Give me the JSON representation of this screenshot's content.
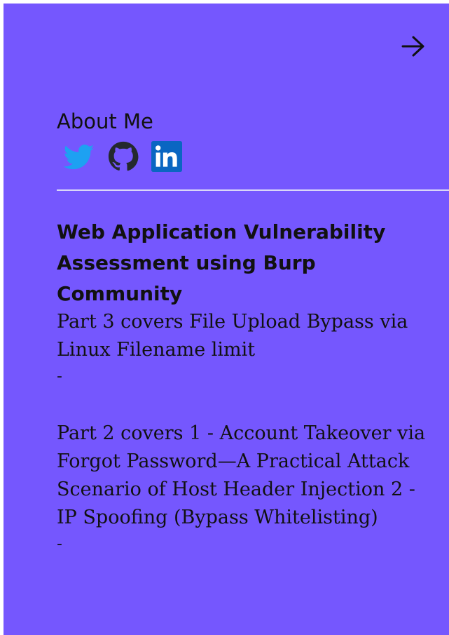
{
  "navigation": {
    "forward_icon": "arrow-right-icon"
  },
  "about": {
    "title": "About Me",
    "social_links": [
      {
        "name": "twitter",
        "icon": "twitter-icon",
        "color": "#1da1f2"
      },
      {
        "name": "github",
        "icon": "github-icon",
        "color": "#24292e"
      },
      {
        "name": "linkedin",
        "icon": "linkedin-icon",
        "color": "#0a66c2"
      }
    ]
  },
  "section": {
    "heading": "Web Application Vulnerability Assessment using Burp Community"
  },
  "posts": [
    {
      "text": "Part 3 covers File Upload Bypass via Linux Filename limit",
      "separator": "-"
    },
    {
      "text": "Part 2 covers 1 - Account Takeover via Forgot Password—A Practical Attack Scenario of Host Header Injection 2 - IP Spoofing (Bypass Whitelisting)",
      "separator": "-"
    }
  ],
  "colors": {
    "panel_background": "#7557fe",
    "divider": "#d9d6f8",
    "text": "#111111"
  }
}
